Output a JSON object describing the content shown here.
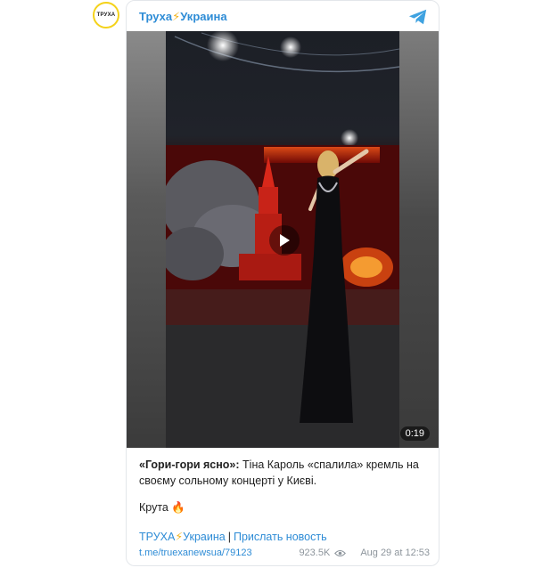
{
  "channel": {
    "avatar_text": "ТРУХА",
    "name_part1": "Труха",
    "name_bolt": "⚡",
    "name_part2": "Украина"
  },
  "video": {
    "duration": "0:19"
  },
  "post": {
    "bold_text": "«Гори-гори ясно»:",
    "body_text": " Тіна Кароль «спалила» кремль на своєму сольному концерті у Києві.",
    "line2_text": "Крута",
    "line2_emoji": "🔥"
  },
  "links": {
    "channel_part1": "ТРУХА",
    "channel_bolt": "⚡",
    "channel_part2": "Украина",
    "separator": "|",
    "submit_news": "Прислать новость"
  },
  "footer": {
    "url": "t.me/truexanewsua/79123",
    "views": "923.5K",
    "date": "Aug 29 at 12:53"
  },
  "colors": {
    "link": "#2e8cd6",
    "accent_yellow": "#f4d21a",
    "meta_gray": "#8d959c"
  }
}
